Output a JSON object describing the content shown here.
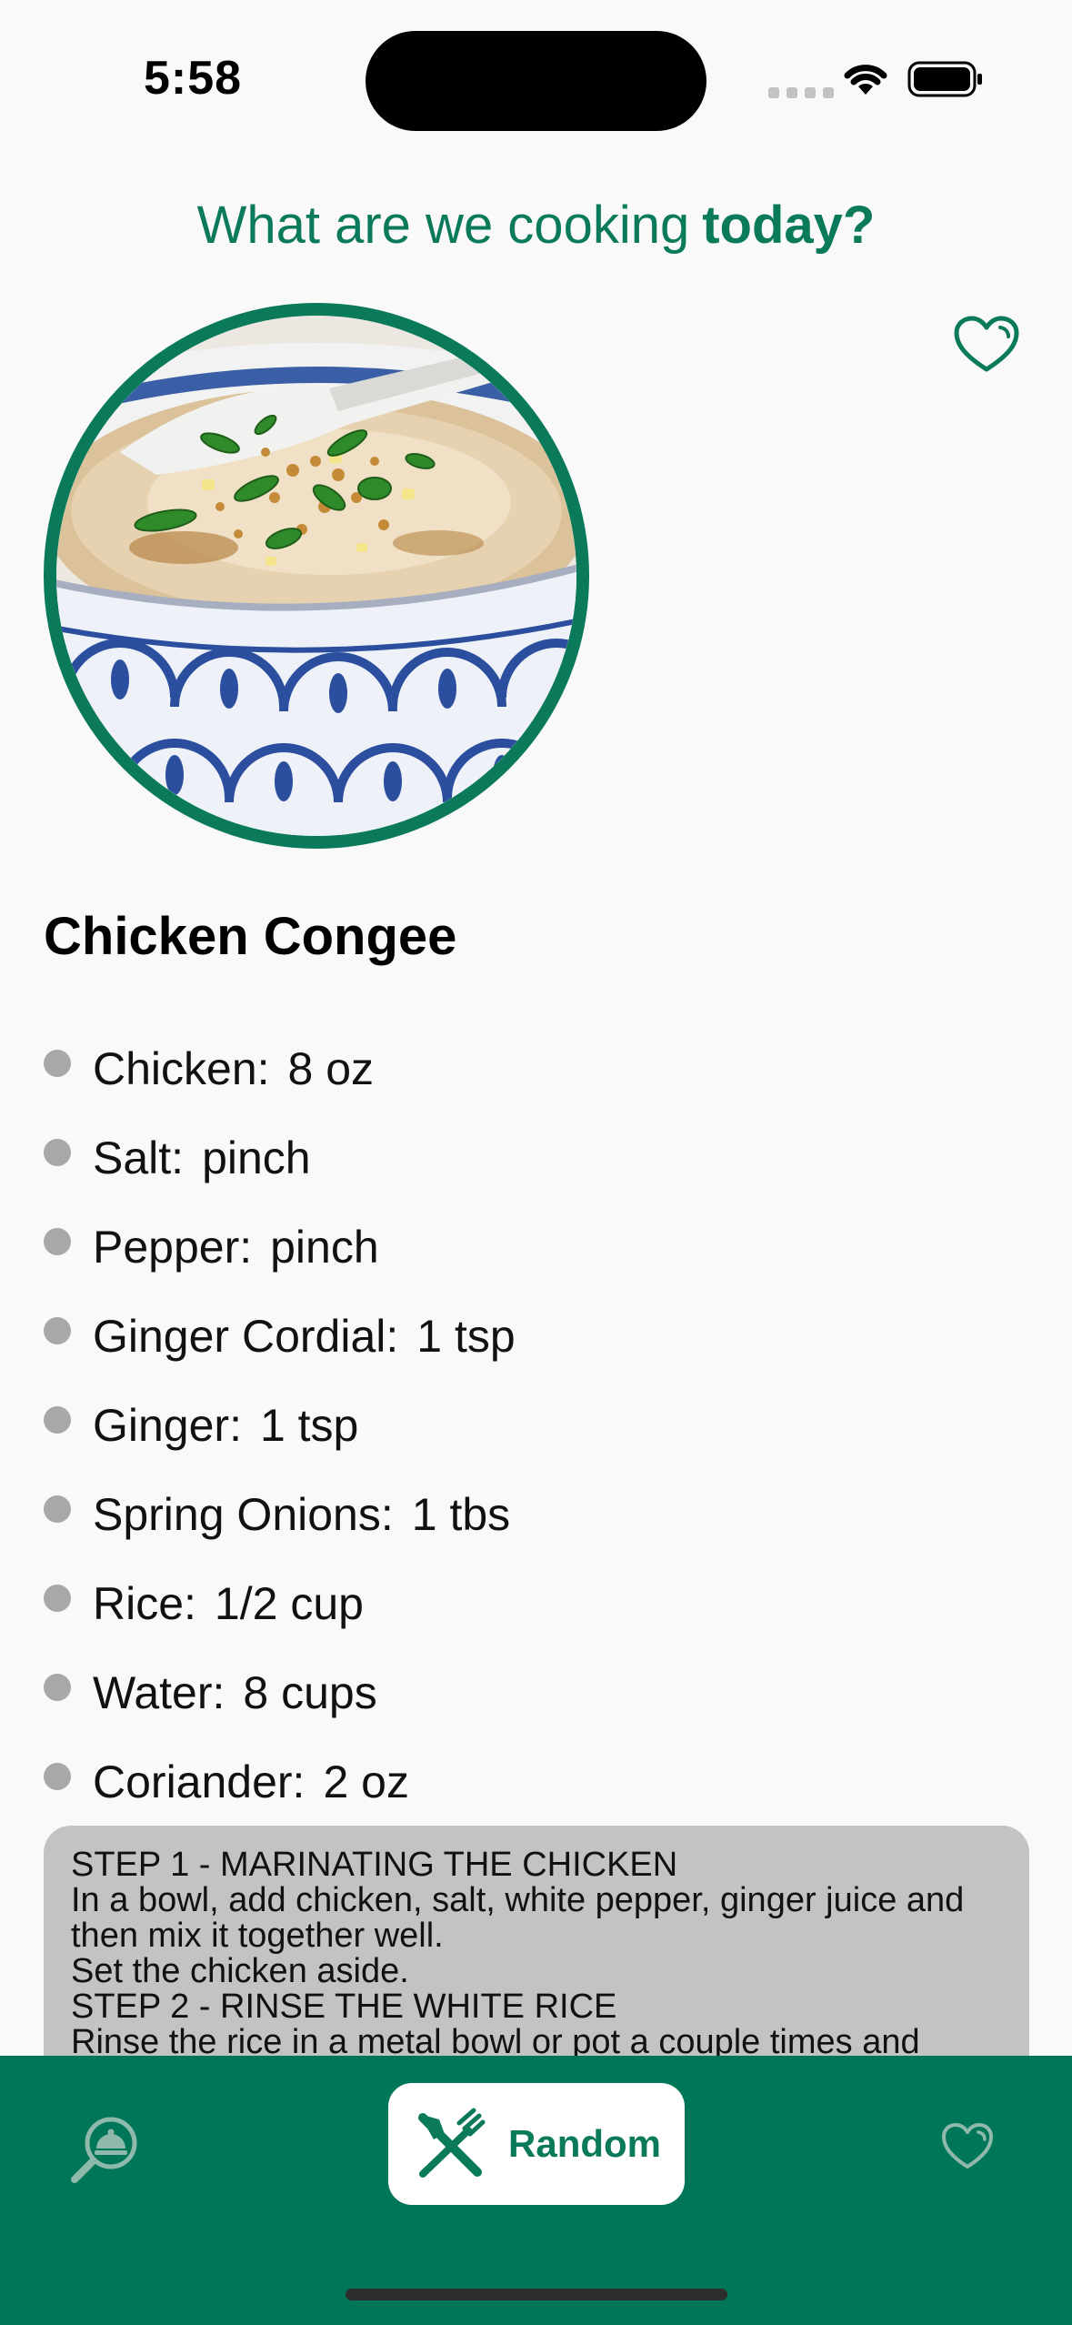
{
  "status_bar": {
    "time": "5:58"
  },
  "header": {
    "title_light": "What are we cooking",
    "title_bold": "today?"
  },
  "recipe": {
    "title": "Chicken Congee",
    "image_alt": "Chicken Congee",
    "ingredients": [
      {
        "name": "Chicken:",
        "quantity": "8 oz"
      },
      {
        "name": "Salt:",
        "quantity": "pinch"
      },
      {
        "name": "Pepper:",
        "quantity": "pinch"
      },
      {
        "name": "Ginger Cordial:",
        "quantity": "1 tsp"
      },
      {
        "name": "Ginger:",
        "quantity": "1 tsp"
      },
      {
        "name": "Spring Onions:",
        "quantity": "1 tbs"
      },
      {
        "name": "Rice:",
        "quantity": "1/2 cup"
      },
      {
        "name": "Water:",
        "quantity": "8 cups"
      },
      {
        "name": "Coriander:",
        "quantity": "2 oz"
      }
    ],
    "instructions": "STEP 1 - MARINATING THE CHICKEN\nIn a bowl, add chicken, salt, white pepper, ginger juice and then mix it together well.\nSet the chicken aside.\nSTEP 2 - RINSE THE WHITE RICE\nRinse the rice in a metal bowl or pot a couple times and"
  },
  "tab_bar": {
    "random_label": "Random"
  },
  "icons": {
    "favourite": "heart-outline-icon",
    "search": "dish-search-icon",
    "random": "fork-knife-icon",
    "favourites_tab": "heart-outline-icon"
  },
  "colors": {
    "brand_green": "#0a7a5b",
    "tab_bar_green": "#007658",
    "instructions_bg": "#c3c3c6",
    "bullet": "#a8a8a8"
  }
}
